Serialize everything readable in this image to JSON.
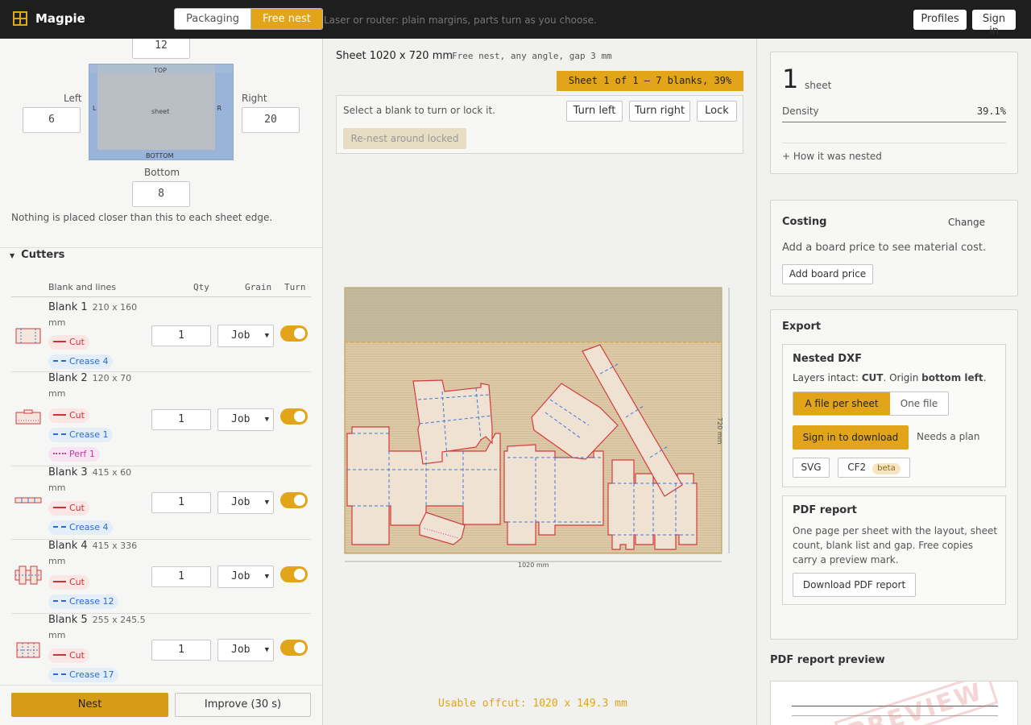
{
  "app": {
    "name": "Magpie",
    "tagline": "Laser or router: plain margins, parts turn as you choose.",
    "mode_tabs": [
      "Packaging",
      "Free nest"
    ],
    "active_tab": "Free nest",
    "profiles_label": "Profiles",
    "signin_label": "Sign in"
  },
  "margins": {
    "top": "12",
    "left_label": "Left",
    "left": "6",
    "right_label": "Right",
    "right": "20",
    "bottom_label": "Bottom",
    "bottom": "8",
    "preview": {
      "top": "TOP",
      "bottom": "BOTTOM",
      "left": "L",
      "right": "R",
      "sheet": "sheet"
    },
    "note": "Nothing is placed closer than this to each sheet edge."
  },
  "cutters": {
    "title": "Cutters",
    "headers": {
      "blank": "Blank and lines",
      "qty": "Qty",
      "grain": "Grain",
      "turn": "Turn"
    },
    "blanks": [
      {
        "name": "Blank 1",
        "dims": "210 x 160",
        "unit": "mm",
        "lines": [
          {
            "kind": "cut",
            "label": "Cut"
          },
          {
            "kind": "crease",
            "label": "Crease 4"
          }
        ],
        "qty": "1",
        "grain": "Job",
        "turn": true
      },
      {
        "name": "Blank 2",
        "dims": "120 x 70",
        "unit": "mm",
        "lines": [
          {
            "kind": "cut",
            "label": "Cut"
          },
          {
            "kind": "crease",
            "label": "Crease 1"
          },
          {
            "kind": "perf",
            "label": "Perf 1"
          }
        ],
        "qty": "1",
        "grain": "Job",
        "turn": true
      },
      {
        "name": "Blank 3",
        "dims": "415 x 60",
        "unit": "mm",
        "lines": [
          {
            "kind": "cut",
            "label": "Cut"
          },
          {
            "kind": "crease",
            "label": "Crease 4"
          }
        ],
        "qty": "1",
        "grain": "Job",
        "turn": true
      },
      {
        "name": "Blank 4",
        "dims": "415 x 336",
        "unit": "mm",
        "lines": [
          {
            "kind": "cut",
            "label": "Cut"
          },
          {
            "kind": "crease",
            "label": "Crease 12"
          }
        ],
        "qty": "1",
        "grain": "Job",
        "turn": true
      },
      {
        "name": "Blank 5",
        "dims": "255 x 245.5",
        "unit": "mm",
        "lines": [
          {
            "kind": "cut",
            "label": "Cut"
          },
          {
            "kind": "crease",
            "label": "Crease 17"
          }
        ],
        "qty": "1",
        "grain": "Job",
        "turn": true
      }
    ]
  },
  "actions": {
    "nest": "Nest",
    "improve": "Improve (30 s)"
  },
  "sheet_view": {
    "title": "Sheet 1020 x 720 mm",
    "subtitle": "Free nest, any angle, gap 3 mm",
    "pager": "Sheet 1 of 1 — 7 blanks, 39%",
    "hint": "Select a blank to turn or lock it.",
    "turn_left": "Turn left",
    "turn_right": "Turn right",
    "lock": "Lock",
    "renest": "Re-nest around locked",
    "width_label": "1020 mm",
    "height_label": "720 mm",
    "offcut": "Usable offcut: 1020 x 149.3 mm",
    "colors": {
      "board": "#dcc9a8",
      "cut": "#d23c3c",
      "crease": "#3b78d8",
      "offcut": "#e2a418"
    }
  },
  "summary": {
    "sheets": "1",
    "sheets_label": "sheet",
    "density_label": "Density",
    "density": "39.1%",
    "how": "+ How it was nested"
  },
  "costing": {
    "title": "Costing",
    "change": "Change",
    "note": "Add a board price to see material cost.",
    "add": "Add board price"
  },
  "export": {
    "title": "Export",
    "dxf": {
      "title": "Nested DXF",
      "desc_prefix": "Layers intact: ",
      "desc_cut": "CUT",
      "desc_mid": ". Origin ",
      "desc_origin": "bottom left",
      "desc_end": ".",
      "per_sheet": "A file per sheet",
      "one_file": "One file",
      "signin": "Sign in to download",
      "needs": "Needs a plan",
      "svg": "SVG",
      "cf2": "CF2",
      "beta": "beta"
    },
    "pdf": {
      "title": "PDF report",
      "desc": "One page per sheet with the layout, sheet count, blank list and gap. Free copies carry a preview mark.",
      "download": "Download PDF report"
    }
  },
  "preview": {
    "title": "PDF report preview",
    "stamp": "PREVIEW"
  }
}
